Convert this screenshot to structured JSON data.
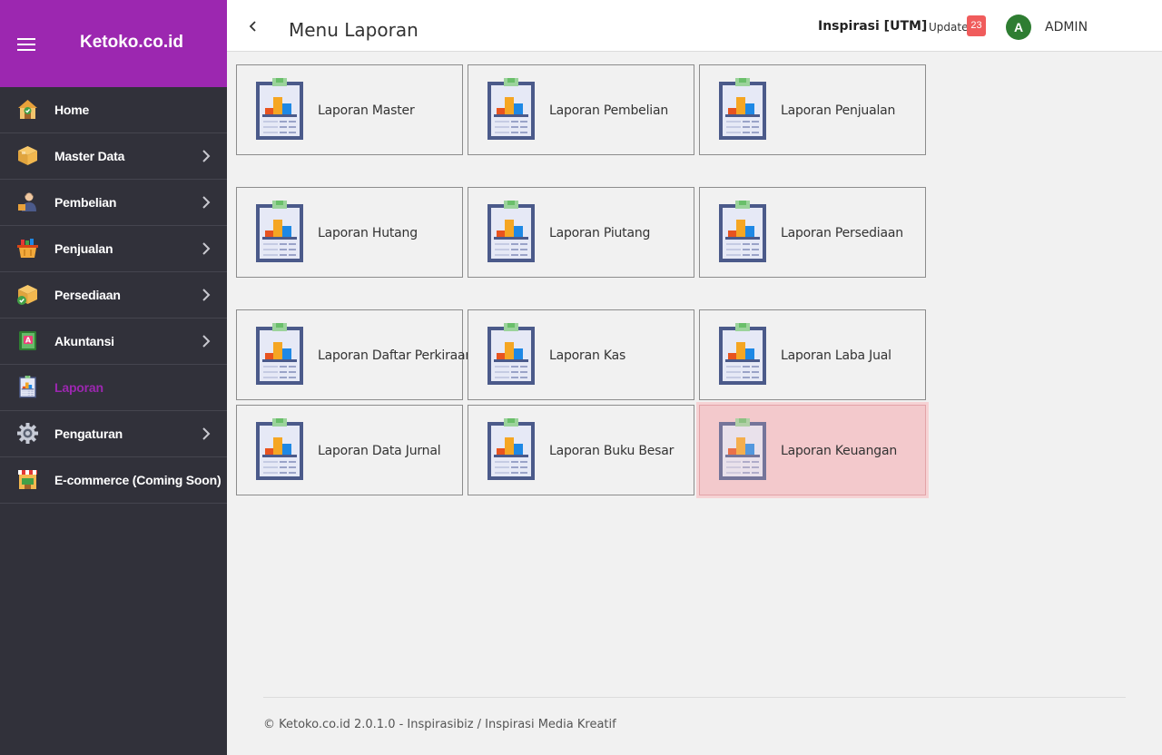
{
  "app": {
    "brand": "Ketoko.co.id",
    "page_title": "Menu Laporan",
    "company": "Inspirasi [UTM]",
    "update_label": "Update",
    "update_count": "23",
    "avatar_initial": "A",
    "username": "ADMIN"
  },
  "sidebar": {
    "items": [
      {
        "label": "Home",
        "icon": "home-icon",
        "has_submenu": false,
        "active": false
      },
      {
        "label": "Master Data",
        "icon": "box-icon",
        "has_submenu": true,
        "active": false
      },
      {
        "label": "Pembelian",
        "icon": "buyer-icon",
        "has_submenu": true,
        "active": false
      },
      {
        "label": "Penjualan",
        "icon": "basket-icon",
        "has_submenu": true,
        "active": false
      },
      {
        "label": "Persediaan",
        "icon": "stock-box-icon",
        "has_submenu": true,
        "active": false
      },
      {
        "label": "Akuntansi",
        "icon": "ledger-book-icon",
        "has_submenu": true,
        "active": false
      },
      {
        "label": "Laporan",
        "icon": "report-clipboard-icon",
        "has_submenu": false,
        "active": true
      },
      {
        "label": "Pengaturan",
        "icon": "gear-icon",
        "has_submenu": true,
        "active": false
      },
      {
        "label": "E-commerce (Coming Soon)",
        "icon": "storefront-icon",
        "has_submenu": false,
        "active": false
      }
    ]
  },
  "reports": [
    {
      "label": "Laporan Master"
    },
    {
      "label": "Laporan Pembelian"
    },
    {
      "label": "Laporan Penjualan"
    },
    {
      "label": "Laporan Hutang"
    },
    {
      "label": "Laporan Piutang"
    },
    {
      "label": "Laporan Persediaan"
    },
    {
      "label": "Laporan Daftar Perkiraan"
    },
    {
      "label": "Laporan Kas"
    },
    {
      "label": "Laporan Laba Jual"
    },
    {
      "label": "Laporan Data Jurnal"
    },
    {
      "label": "Laporan Buku Besar"
    },
    {
      "label": "Laporan Keuangan"
    }
  ],
  "footer": {
    "text": "© Ketoko.co.id 2.0.1.0 - Inspirasibiz / Inspirasi Media Kreatif"
  },
  "colors": {
    "brand": "#9c27b0",
    "sidebar_bg": "#31313a",
    "badge": "#f05c5c",
    "avatar": "#2e7d32",
    "hover_card": "#f3c9cc"
  }
}
